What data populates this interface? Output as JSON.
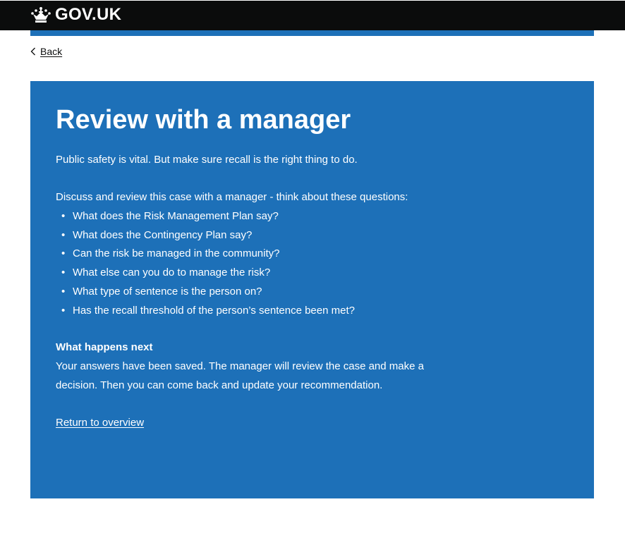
{
  "header": {
    "logo_text": "GOV.UK"
  },
  "nav": {
    "back_label": "Back"
  },
  "panel": {
    "title": "Review with a manager",
    "intro": "Public safety is vital. But make sure recall is the right thing to do.",
    "discuss": "Discuss and review this case with a manager - think about these questions:",
    "questions": [
      "What does the Risk Management Plan say?",
      "What does the Contingency Plan say?",
      "Can the risk be managed in the community?",
      "What else can you do to manage the risk?",
      "What type of sentence is the person on?",
      "Has the recall threshold of the person’s sentence been met?"
    ],
    "next_heading": "What happens next",
    "next_body": "Your answers have been saved. The manager will review the case and make a decision. Then you can come back and update your recommendation.",
    "return_link": "Return to overview"
  },
  "colors": {
    "header_bg": "#0b0c0c",
    "panel_bg": "#1d70b8",
    "text_on_panel": "#ffffff"
  },
  "icons": {
    "logo": "crown-icon",
    "back": "chevron-left-icon"
  }
}
